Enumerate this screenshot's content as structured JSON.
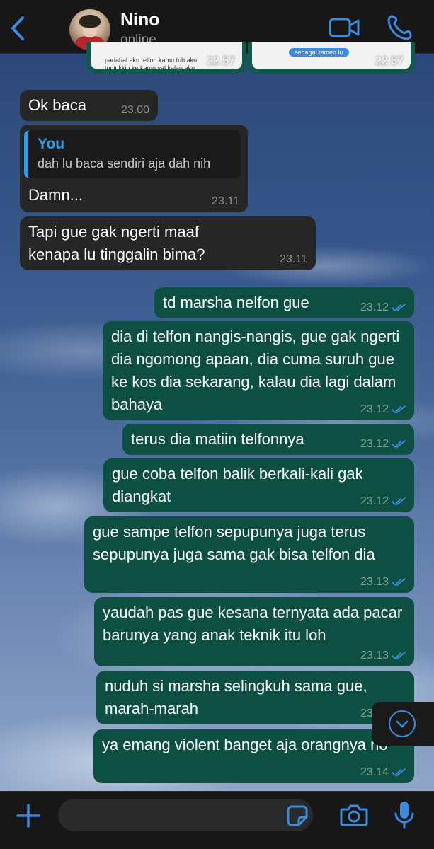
{
  "header": {
    "contact_name": "Nino",
    "status": "online"
  },
  "previews": [
    {
      "text": "padahal aku telfon kamu tuh aku tunjukkin ke kamu yal kalau aku",
      "time": "22.57"
    },
    {
      "text": "sebagai temen lu",
      "time": "22.57"
    }
  ],
  "messages": [
    {
      "dir": "in",
      "text": "Ok baca",
      "time": "23.00"
    },
    {
      "dir": "in",
      "quote_name": "You",
      "quote_text": "dah lu baca sendiri aja dah nih",
      "text": "Damn...",
      "time": "23.11"
    },
    {
      "dir": "in",
      "text": "Tapi gue gak ngerti maaf kenapa lu tinggalin bima?",
      "time": "23.11"
    },
    {
      "dir": "out",
      "text": "td marsha nelfon gue",
      "time": "23.12"
    },
    {
      "dir": "out",
      "text": "dia di telfon nangis-nangis, gue gak ngerti dia ngomong apaan, dia cuma suruh gue ke kos dia sekarang, kalau dia lagi dalam bahaya",
      "time": "23.12"
    },
    {
      "dir": "out",
      "text": "terus dia matiin telfonnya",
      "time": "23.12"
    },
    {
      "dir": "out",
      "text": "gue coba telfon balik berkali-kali gak diangkat",
      "time": "23.12"
    },
    {
      "dir": "out",
      "text": "gue sampe telfon sepupunya juga terus sepupunya juga sama gak bisa telfon dia",
      "time": "23.13"
    },
    {
      "dir": "out",
      "text": "yaudah pas gue kesana ternyata ada pacar barunya yang anak teknik itu loh",
      "time": "23.13"
    },
    {
      "dir": "out",
      "text": "nuduh si marsha selingkuh sama gue, marah-marah",
      "time": "23.13"
    },
    {
      "dir": "out",
      "text": "ya emang violent banget aja orangnya no",
      "time": "23.14"
    }
  ],
  "composer": {
    "placeholder": "",
    "value": ""
  },
  "colors": {
    "accent": "#3b8ce0",
    "incoming_bubble": "#262626",
    "outgoing_bubble": "#0d4f42",
    "quote_accent": "#2f9ee6"
  },
  "icons": {
    "back": "chevron-left-icon",
    "video": "video-camera-icon",
    "call": "phone-icon",
    "add": "plus-icon",
    "sticker": "sticker-icon",
    "camera": "camera-icon",
    "mic": "microphone-icon",
    "read": "double-check-icon",
    "scroll": "chevron-down-icon"
  }
}
